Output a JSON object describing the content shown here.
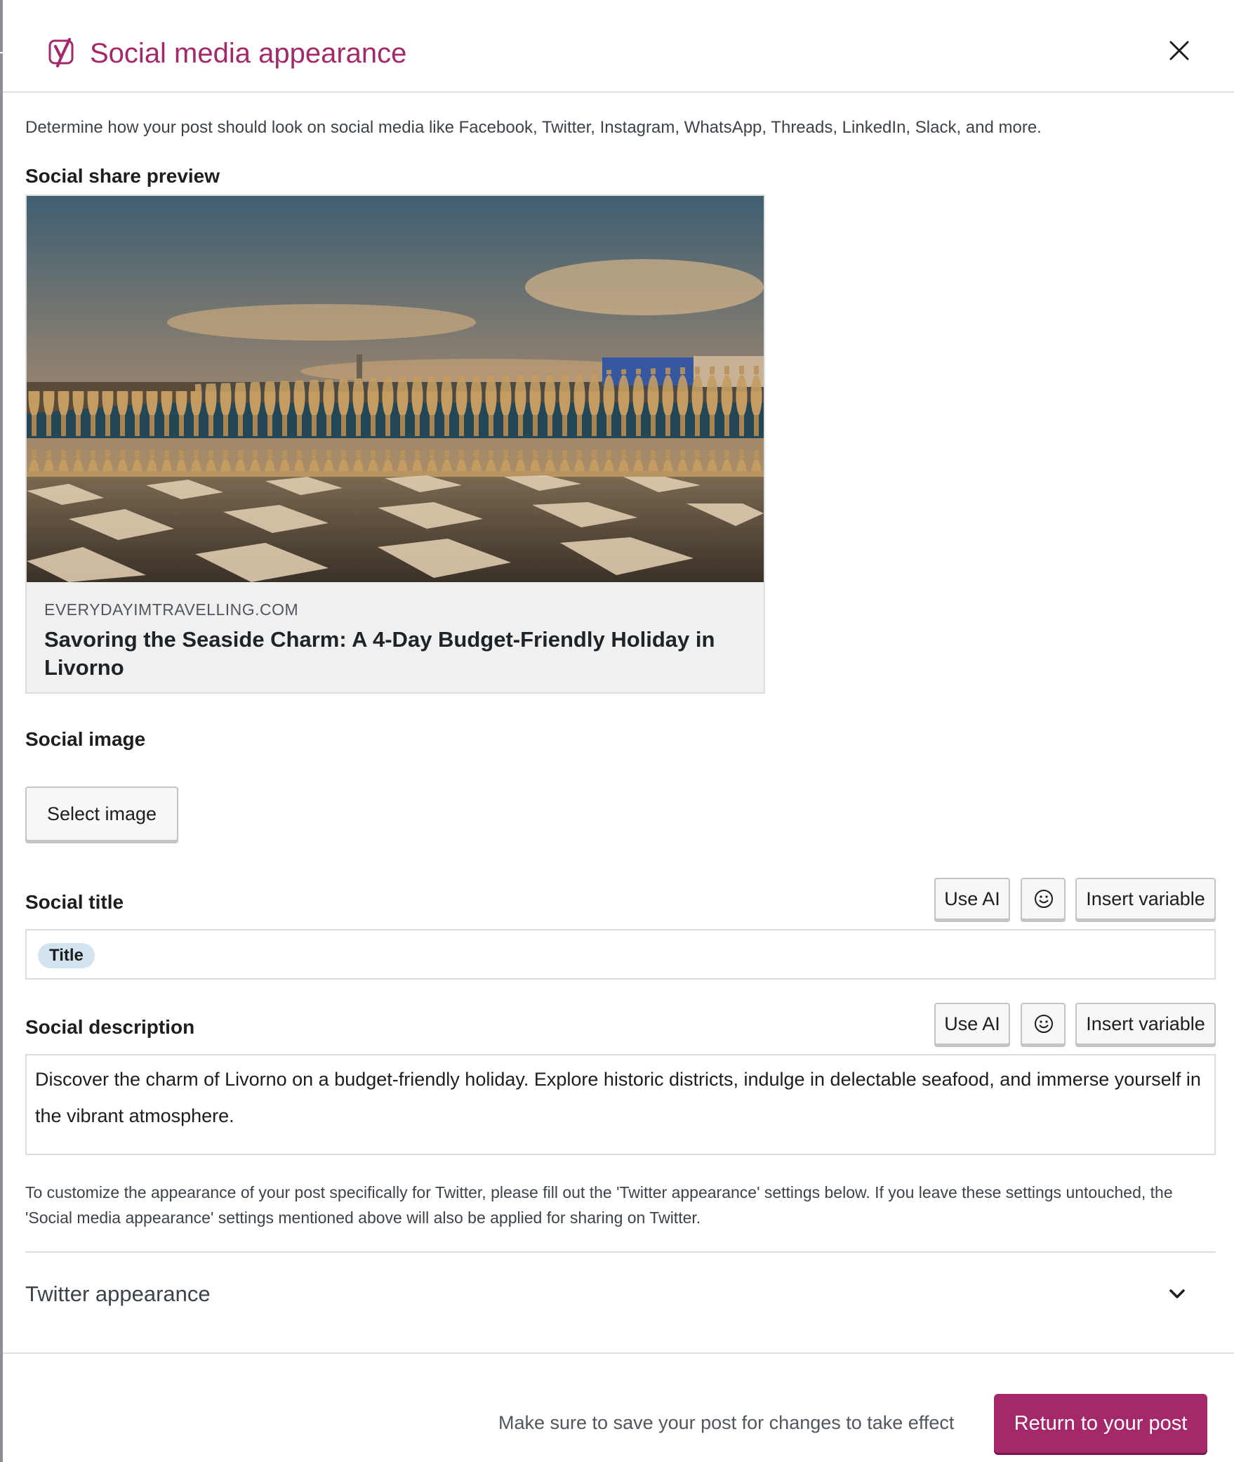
{
  "modal": {
    "title": "Social media appearance",
    "intro": "Determine how your post should look on social media like Facebook, Twitter, Instagram, WhatsApp, Threads, LinkedIn, Slack, and more."
  },
  "preview": {
    "label": "Social share preview",
    "domain": "EVERYDAYIMTRAVELLING.COM",
    "title": "Savoring the Seaside Charm: A 4-Day Budget-Friendly Holiday in Livorno"
  },
  "social_image": {
    "label": "Social image",
    "button": "Select image"
  },
  "social_title": {
    "label": "Social title",
    "use_ai": "Use AI",
    "insert_variable": "Insert variable",
    "variable_pill": "Title"
  },
  "social_description": {
    "label": "Social description",
    "use_ai": "Use AI",
    "insert_variable": "Insert variable",
    "value": "Discover the charm of Livorno on a budget-friendly holiday. Explore historic districts, indulge in delectable seafood, and immerse yourself in the vibrant atmosphere."
  },
  "twitter": {
    "note": "To customize the appearance of your post specifically for Twitter, please fill out the 'Twitter appearance' settings below. If you leave these settings untouched, the 'Social media appearance' settings mentioned above will also be applied for sharing on Twitter.",
    "section_label": "Twitter appearance",
    "expanded": false
  },
  "footer": {
    "note": "Make sure to save your post for changes to take effect",
    "return_button": "Return to your post"
  },
  "icons": {
    "logo": "yoast-logo-icon",
    "close": "close-icon",
    "emoji": "smiley-icon",
    "chevron": "chevron-down-icon"
  },
  "colors": {
    "brand": "#a4286a",
    "pill": "#d4e3f0",
    "card_background": "#f0f0f1"
  }
}
